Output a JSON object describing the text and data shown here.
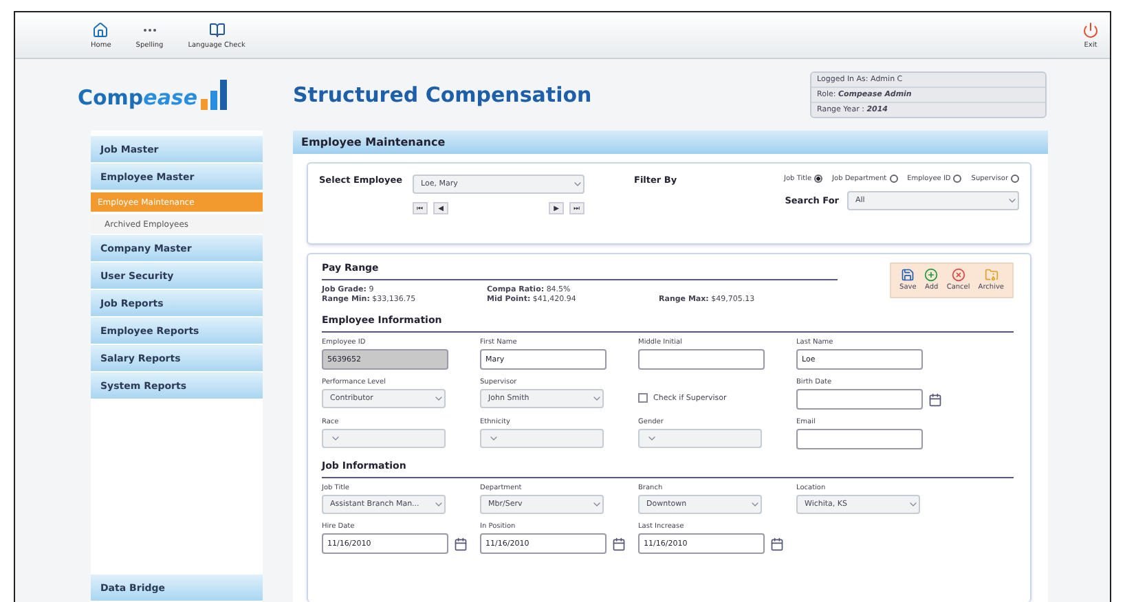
{
  "toolbar": {
    "items": [
      {
        "label": "Home",
        "kind": "home"
      },
      {
        "label": "Spelling",
        "kind": "spelling"
      },
      {
        "label": "Language Check",
        "kind": "language"
      }
    ],
    "exit": {
      "label": "Exit"
    }
  },
  "logo": {
    "text": "Comp",
    "accent": "ease"
  },
  "title": "Structured Compensation",
  "session": [
    "Logged In As: Admin C",
    "Role: **Compease Admin**",
    "Range Year : **2014**"
  ],
  "sidebar": {
    "items": [
      {
        "label": "Job Master"
      },
      {
        "label": "Employee Master",
        "children": [
          {
            "label": "Employee Maintenance",
            "selected": true
          },
          {
            "label": "Archived Employees",
            "selected": false
          }
        ]
      },
      {
        "label": "Company Master"
      },
      {
        "label": "User Security"
      },
      {
        "label": "Job Reports"
      },
      {
        "label": "Employee Reports"
      },
      {
        "label": "Salary Reports"
      },
      {
        "label": "System Reports"
      }
    ],
    "footer": "Data Bridge"
  },
  "panel": {
    "title": "Employee Maintenance",
    "select_employee": {
      "label": "Select Employee",
      "value": "Loe, Mary",
      "nav": [
        "⏮",
        "◀",
        "▶",
        "⏭"
      ]
    },
    "filter": {
      "label": "Filter By",
      "options": [
        {
          "label": "Job Title",
          "selected": true
        },
        {
          "label": "Job Department",
          "selected": false
        },
        {
          "label": "Employee ID",
          "selected": false
        },
        {
          "label": "Supervisor",
          "selected": false
        }
      ],
      "search_label": "Search For",
      "search_value": "All"
    },
    "pay_range": {
      "title": "Pay Range",
      "stats": [
        [
          {
            "label": "Job Grade:",
            "value": "9"
          },
          {
            "label": "Range Min:",
            "value": "$33,136.75"
          }
        ],
        [
          {
            "label": "Compa Ratio:",
            "value": "84.5%"
          },
          {
            "label": "Mid Point:",
            "value": "$41,420.94"
          }
        ],
        [
          {
            "label": "Range Max:",
            "value": "$49,705.13"
          }
        ]
      ]
    },
    "actions": [
      {
        "label": "Save",
        "kind": "save"
      },
      {
        "label": "Add",
        "kind": "add"
      },
      {
        "label": "Cancel",
        "kind": "cancel"
      },
      {
        "label": "Archive",
        "kind": "archive"
      }
    ],
    "sections": [
      {
        "title": "Employee Information",
        "rows": [
          [
            {
              "kind": "text",
              "label": "Employee ID",
              "value": "5639652",
              "disabled": true
            },
            {
              "kind": "text",
              "label": "First Name",
              "value": "Mary",
              "disabled": false
            },
            {
              "kind": "text",
              "label": "Middle Initial",
              "disabled": false
            },
            {
              "kind": "text",
              "label": "Last Name",
              "value": "Loe",
              "disabled": false
            }
          ],
          [
            {
              "kind": "select",
              "label": "Performance Level",
              "value": "Contributor"
            },
            {
              "kind": "select",
              "label": "Supervisor",
              "value": "John Smith"
            },
            {
              "kind": "checkbox",
              "label": "Check if Supervisor",
              "checked": false
            },
            {
              "kind": "date",
              "label": "Birth Date"
            }
          ],
          [
            {
              "kind": "select",
              "label": "Race"
            },
            {
              "kind": "select",
              "label": "Ethnicity"
            },
            {
              "kind": "select",
              "label": "Gender"
            },
            {
              "kind": "text",
              "label": "Email",
              "disabled": false
            }
          ]
        ]
      },
      {
        "title": "Job Information",
        "rows": [
          [
            {
              "kind": "select",
              "label": "Job Title",
              "value": "Assistant Branch Man..."
            },
            {
              "kind": "select",
              "label": "Department",
              "value": "Mbr/Serv"
            },
            {
              "kind": "select",
              "label": "Branch",
              "value": "Downtown"
            },
            {
              "kind": "select",
              "label": "Location",
              "value": "Wichita, KS"
            }
          ],
          [
            {
              "kind": "date",
              "label": "Hire Date",
              "value": "11/16/2010"
            },
            {
              "kind": "date",
              "label": "In Position",
              "value": "11/16/2010"
            },
            {
              "kind": "date",
              "label": "Last Increase",
              "value": "11/16/2010"
            }
          ]
        ]
      }
    ]
  }
}
